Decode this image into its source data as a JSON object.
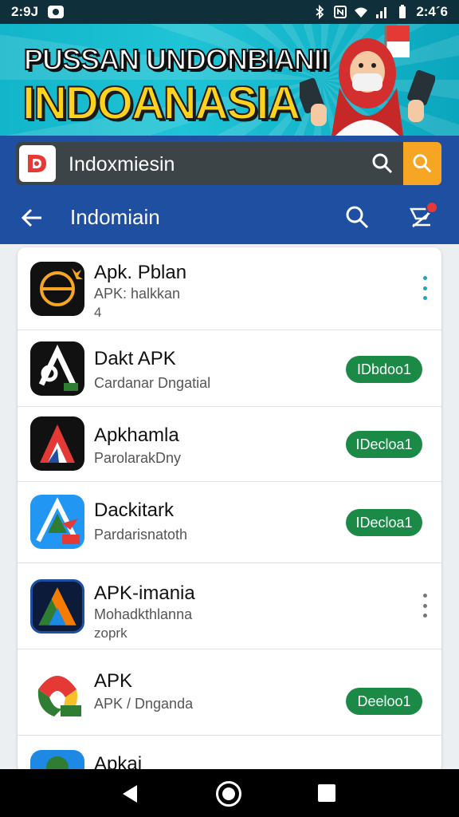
{
  "status_bar": {
    "time_left": "2:9J",
    "time_right": "2:4´6",
    "icons": [
      "notification-icon",
      "bluetooth-icon",
      "nfc-icon",
      "wifi-icon",
      "signal-icon",
      "battery-icon"
    ]
  },
  "banner": {
    "title": "PUSSAN UNDONBIANII",
    "subtitle": "INDOANASIA"
  },
  "search": {
    "query": "Indoxmiesin",
    "icon": "search-icon"
  },
  "toolbar": {
    "title": "Indomiain",
    "back_icon": "back-arrow-icon",
    "search_icon": "search-icon",
    "cart_icon": "cart-icon"
  },
  "apps": [
    {
      "name": "Apk. Pblan",
      "subtitle": "APK: halkkan",
      "meta": "4",
      "action": "more"
    },
    {
      "name": "Dakt APK",
      "subtitle": "Cardanar Dngatial",
      "meta": "",
      "action": "IDbdoo1"
    },
    {
      "name": "Apkhamla",
      "subtitle": "ParolarakDny",
      "meta": "",
      "action": "IDecloa1"
    },
    {
      "name": "Dackitark",
      "subtitle": "Pardarisnatoth",
      "meta": "",
      "action": "IDecloa1"
    },
    {
      "name": "APK-imania",
      "subtitle": "Mohadkthlanna",
      "meta": "zoprk",
      "action": "more"
    },
    {
      "name": "APK",
      "subtitle": "APK / Dnganda",
      "meta": "",
      "action": "Deeloo1"
    },
    {
      "name": "Apkai",
      "subtitle": "",
      "meta": "",
      "action": ""
    }
  ],
  "colors": {
    "brand_blue": "#1e4fa0",
    "download_green": "#1a8a46",
    "banner_teal": "#12b5c9",
    "search_orange": "#f6a623"
  }
}
